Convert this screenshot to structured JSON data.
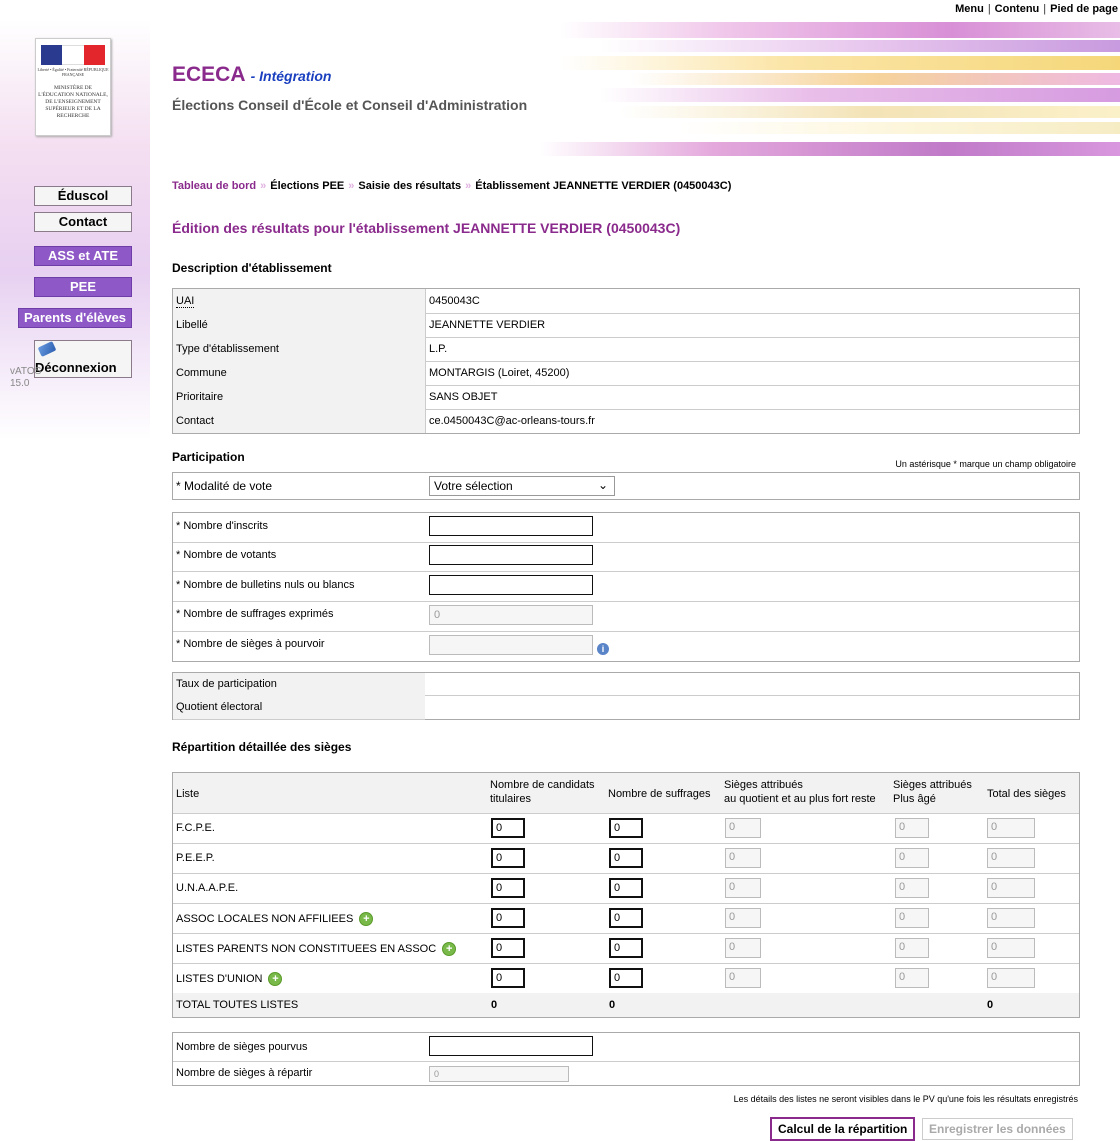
{
  "top_links": [
    "Menu",
    "Contenu",
    "Pied de page"
  ],
  "logo": {
    "republic": "Liberté • Égalité • Fraternité RÉPUBLIQUE FRANÇAISE",
    "ministry": "Ministère de l'Éducation nationale, de l'Enseignement supérieur et de la Recherche"
  },
  "nav": {
    "eduscol": "Éduscol",
    "contact": "Contact",
    "ass_ate": "ASS et ATE",
    "pee": "PEE",
    "parents": "Parents d'élèves",
    "logout": "Déconnexion",
    "version_name": "vATOS",
    "version_num": "15.0"
  },
  "header": {
    "app": "ECECA",
    "env": "- Intégration",
    "subtitle": "Élections Conseil d'École et Conseil d'Administration"
  },
  "breadcrumb": [
    "Tableau de bord",
    "Élections PEE",
    "Saisie des résultats",
    "Établissement JEANNETTE VERDIER (0450043C)"
  ],
  "page_title": "Édition des résultats pour l'établissement JEANNETTE VERDIER (0450043C)",
  "desc": {
    "heading": "Description d'établissement",
    "rows": [
      {
        "label": "UAI",
        "value": "0450043C"
      },
      {
        "label": "Libellé",
        "value": "JEANNETTE VERDIER"
      },
      {
        "label": "Type d'établissement",
        "value": "L.P."
      },
      {
        "label": "Commune",
        "value": "MONTARGIS (Loiret, 45200)"
      },
      {
        "label": "Prioritaire",
        "value": "SANS OBJET"
      },
      {
        "label": "Contact",
        "value": "ce.0450043C@ac-orleans-tours.fr"
      }
    ]
  },
  "participation": {
    "heading": "Participation",
    "note": "Un astérisque * marque un champ obligatoire",
    "modalite_label": "* Modalité de vote",
    "modalite_value": "Votre sélection",
    "inscrits": "* Nombre d'inscrits",
    "votants": "* Nombre de votants",
    "nuls": "* Nombre de bulletins nuls ou blancs",
    "exprimes": "* Nombre de suffrages exprimés",
    "exprimes_value": "0",
    "sieges": "* Nombre de sièges à pourvoir",
    "taux": "Taux de participation",
    "quotient": "Quotient électoral"
  },
  "repartition": {
    "heading": "Répartition détaillée des sièges",
    "headers": {
      "liste": "Liste",
      "cand": [
        "Nombre de candidats",
        "titulaires"
      ],
      "suff": "Nombre de suffrages",
      "quot": [
        "Sièges attribués",
        "au quotient et au plus fort reste"
      ],
      "age": [
        "Sièges attribués",
        "Plus âgé"
      ],
      "total": "Total des sièges"
    },
    "rows": [
      {
        "name": "F.C.P.E.",
        "plus": false
      },
      {
        "name": "P.E.E.P.",
        "plus": false
      },
      {
        "name": "U.N.A.A.P.E.",
        "plus": false
      },
      {
        "name": "ASSOC LOCALES NON AFFILIEES",
        "plus": true
      },
      {
        "name": "LISTES PARENTS NON CONSTITUEES EN ASSOC",
        "plus": true
      },
      {
        "name": "LISTES D'UNION",
        "plus": true
      }
    ],
    "cell_value": "0",
    "total": {
      "label": "TOTAL TOUTES LISTES",
      "cand": "0",
      "suff": "0",
      "total": "0"
    }
  },
  "pourvus": {
    "label": "Nombre de sièges pourvus",
    "repartir": "Nombre de sièges à répartir",
    "repartir_value": "0"
  },
  "footer_note": "Les détails des listes ne seront visibles dans le PV qu'une fois les résultats enregistrés",
  "buttons": {
    "calc": "Calcul de la répartition",
    "save": "Enregistrer les données"
  }
}
